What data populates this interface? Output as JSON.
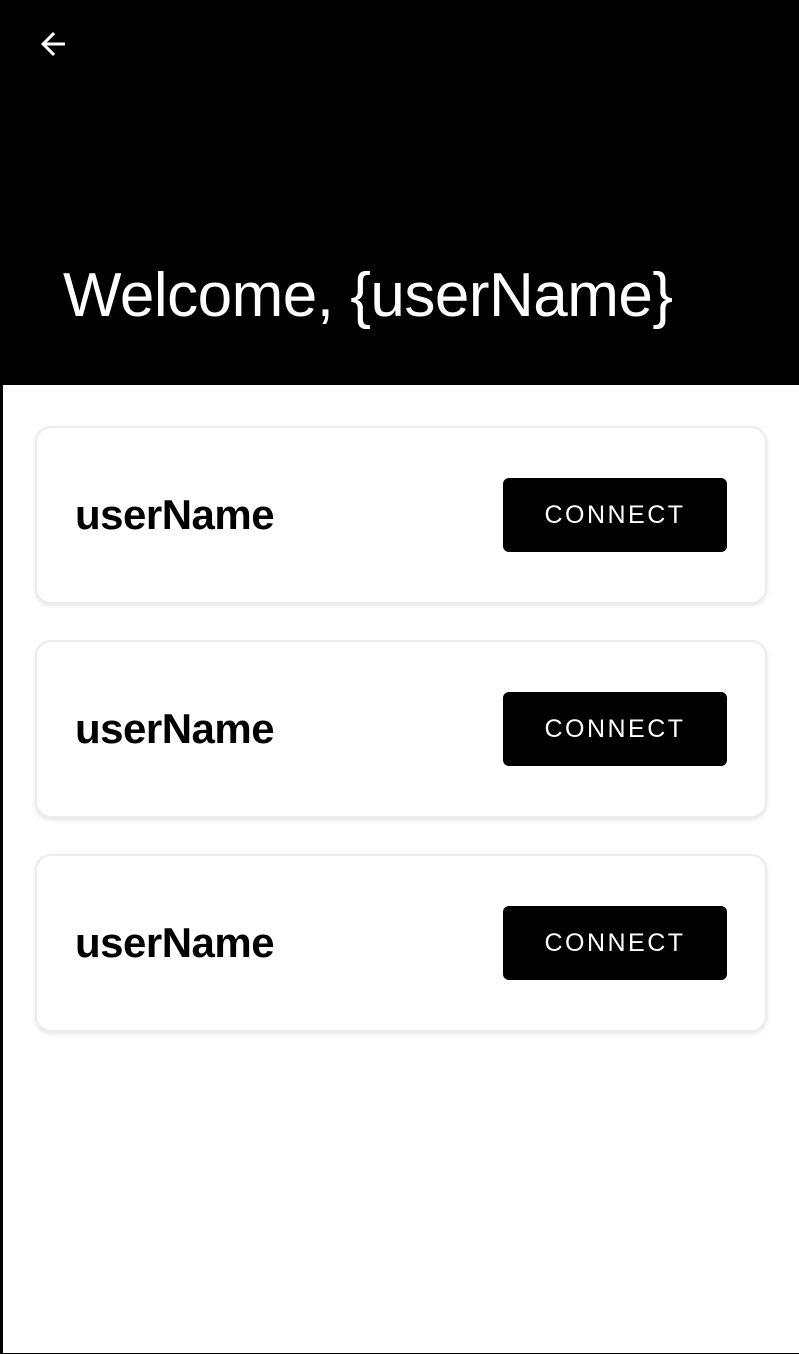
{
  "app_bar": {
    "back_icon": "arrow-left-icon",
    "title": "Welcome, {userName}",
    "background": "#000000",
    "text_color": "#ffffff"
  },
  "users": [
    {
      "name": "userName",
      "action_label": "CONNECT"
    },
    {
      "name": "userName",
      "action_label": "CONNECT"
    },
    {
      "name": "userName",
      "action_label": "CONNECT"
    }
  ],
  "colors": {
    "button_background": "#000000",
    "button_text": "#ffffff",
    "card_background": "#ffffff"
  }
}
